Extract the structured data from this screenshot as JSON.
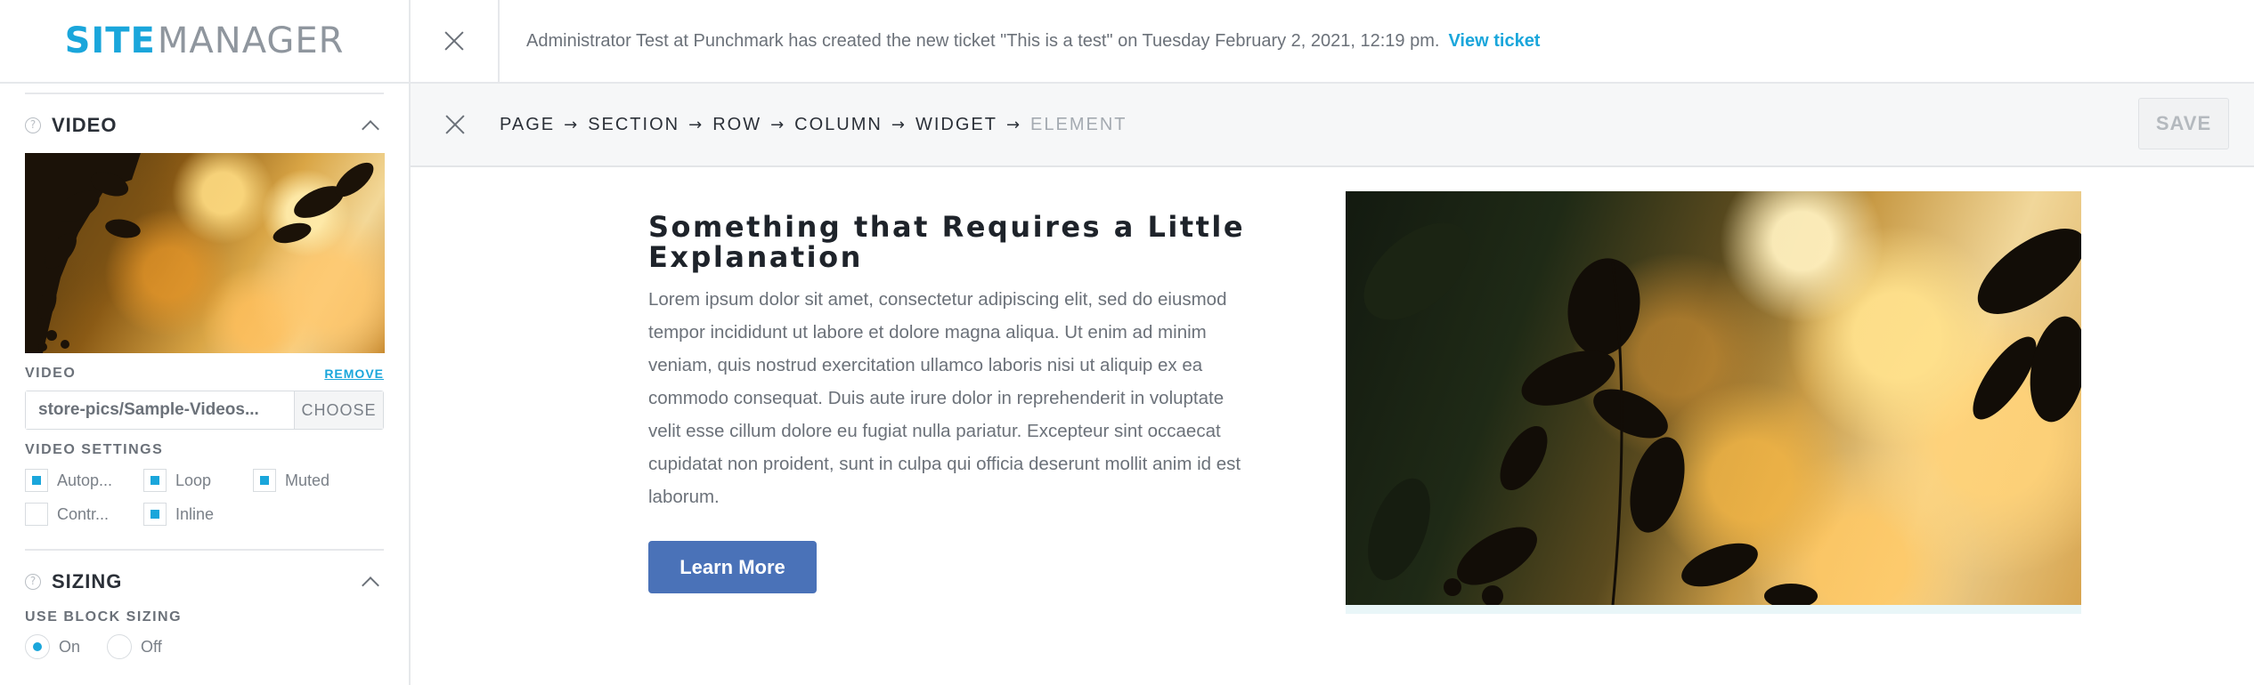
{
  "logo": {
    "site": "SITE",
    "manager": "MANAGER"
  },
  "notification": {
    "text": "Administrator Test at Punchmark has created the new ticket \"This is a test\" on Tuesday February 2, 2021, 12:19 pm.",
    "link": "View ticket"
  },
  "breadcrumb": {
    "items": [
      "PAGE",
      "SECTION",
      "ROW",
      "COLUMN",
      "WIDGET",
      "ELEMENT"
    ],
    "separator": "→",
    "save_label": "SAVE"
  },
  "sidebar": {
    "video_section": {
      "title": "VIDEO",
      "video_label": "VIDEO",
      "remove_label": "REMOVE",
      "video_value": "store-pics/Sample-Videos...",
      "choose_label": "CHOOSE",
      "settings_label": "VIDEO SETTINGS",
      "settings": [
        {
          "label": "Autop...",
          "checked": true
        },
        {
          "label": "Loop",
          "checked": true
        },
        {
          "label": "Muted",
          "checked": true
        },
        {
          "label": "Contr...",
          "checked": false
        },
        {
          "label": "Inline",
          "checked": true
        }
      ]
    },
    "sizing_section": {
      "title": "SIZING",
      "block_sizing_label": "USE BLOCK SIZING",
      "on_label": "On",
      "off_label": "Off",
      "selected": "On"
    }
  },
  "content": {
    "headline": "Something that Requires a Little Explanation",
    "body": "Lorem ipsum dolor sit amet, consectetur adipiscing elit, sed do eiusmod tempor incididunt ut labore et dolore magna aliqua. Ut enim ad minim veniam, quis nostrud exercitation ullamco laboris nisi ut aliquip ex ea commodo consequat. Duis aute irure dolor in reprehenderit in voluptate velit esse cillum dolore eu fugiat nulla pariatur. Excepteur sint occaecat cupidatat non proident, sunt in culpa qui officia deserunt mollit anim id est laborum.",
    "button_label": "Learn More"
  },
  "colors": {
    "accent": "#1aa6db",
    "button": "#4a72b8",
    "text": "#6b7179"
  }
}
